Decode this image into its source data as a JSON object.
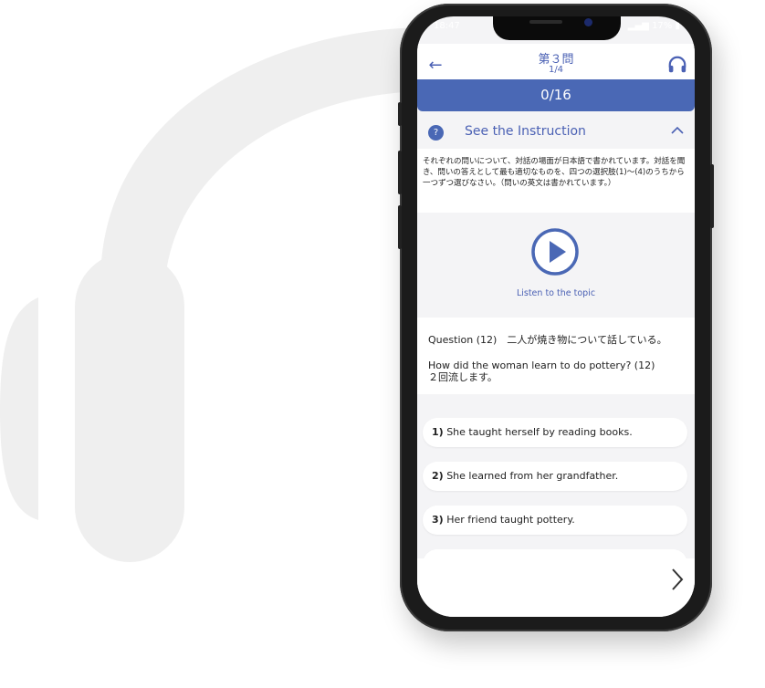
{
  "status_bar": {
    "time": "18:47",
    "battery": "17%"
  },
  "header": {
    "title": "第３問",
    "subtitle": "1/4"
  },
  "score": "0/16",
  "instruction": {
    "label": "See the Instruction",
    "text": "それぞれの問いについて、対話の場面が日本語で書かれています。対話を聞き、問いの答えとして最も適切なものを、四つの選択肢(1)〜(4)のうちから一つずつ選びなさい。（問いの英文は書かれています。）"
  },
  "player": {
    "label": "Listen to the topic"
  },
  "question": {
    "context": "Question (12)　二人が焼き物について話している。",
    "prompt": "How did the woman learn to do pottery? (12)",
    "note": "２回流します。"
  },
  "answers": [
    {
      "num": "1)",
      "text": "She taught herself by reading books."
    },
    {
      "num": "2)",
      "text": "She learned from her grandfather."
    },
    {
      "num": "3)",
      "text": "Her friend taught pottery."
    }
  ],
  "colors": {
    "accent": "#4a68b5",
    "background": "#f4f4f6",
    "headphone_bg": "#efefef"
  },
  "icons": {
    "back": "arrow-left-icon",
    "audio": "headphones-icon",
    "help": "question-icon",
    "collapse": "chevron-up-icon",
    "play": "play-icon",
    "next": "chevron-right-icon"
  }
}
